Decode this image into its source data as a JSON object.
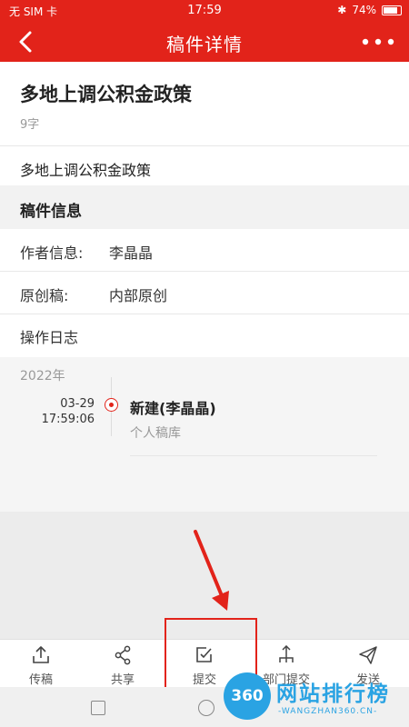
{
  "status_bar": {
    "carrier": "无 SIM 卡",
    "time": "17:59",
    "battery": "74%"
  },
  "nav": {
    "title": "稿件详情"
  },
  "article": {
    "title": "多地上调公积金政策",
    "word_count": "9字",
    "summary": "多地上调公积金政策"
  },
  "info": {
    "section_title": "稿件信息",
    "author_label": "作者信息:",
    "author_value": "李晶晶",
    "original_label": "原创稿:",
    "original_value": "内部原创"
  },
  "log": {
    "title": "操作日志",
    "year": "2022年",
    "entries": [
      {
        "date": "03-29",
        "time": "17:59:06",
        "event": "新建(李晶晶)",
        "location": "个人稿库"
      }
    ]
  },
  "tabs": [
    {
      "label": "传稿",
      "icon": "upload-icon"
    },
    {
      "label": "共享",
      "icon": "share-icon"
    },
    {
      "label": "提交",
      "icon": "submit-icon"
    },
    {
      "label": "部门提交",
      "icon": "branch-icon"
    },
    {
      "label": "发送",
      "icon": "send-icon"
    }
  ],
  "watermark": {
    "badge": "360",
    "name": "网站排行榜",
    "domain": "-WANGZHAN360.CN-"
  },
  "colors": {
    "accent": "#e2231a",
    "watermark": "#2aa3e3"
  }
}
